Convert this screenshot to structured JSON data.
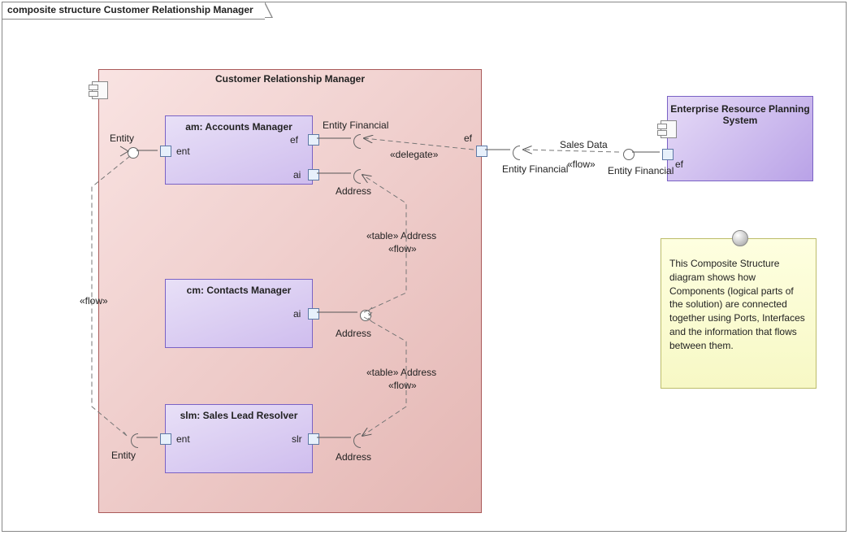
{
  "frame_title": "composite structure Customer Relationship Manager",
  "crm": {
    "title": "Customer Relationship Manager",
    "components": {
      "am": {
        "title": "am: Accounts Manager",
        "port_ent": "ent",
        "port_ef": "ef",
        "port_ai": "ai",
        "ef_interface": "Entity Financial",
        "ai_interface": "Address"
      },
      "cm": {
        "title": "cm: Contacts Manager",
        "port_ai": "ai",
        "ai_interface": "Address"
      },
      "slm": {
        "title": "slm: Sales Lead Resolver",
        "port_ent": "ent",
        "port_slr": "slr",
        "slr_interface": "Address"
      }
    },
    "entity_label": "Entity",
    "big_port_ef": "ef",
    "big_port_ef_interface": "Entity Financial",
    "flow_label": "«flow»",
    "delegate_label": "«delegate»",
    "table_address": "«table» Address"
  },
  "erp": {
    "title": "Enterprise Resource Planning System",
    "port_ef": "ef",
    "ef_interface": "Entity Financial",
    "sales_data": "Sales Data"
  },
  "note_text": "This Composite Structure diagram shows how Components (logical parts of the solution) are connected together using Ports, Interfaces and the information that flows between them."
}
